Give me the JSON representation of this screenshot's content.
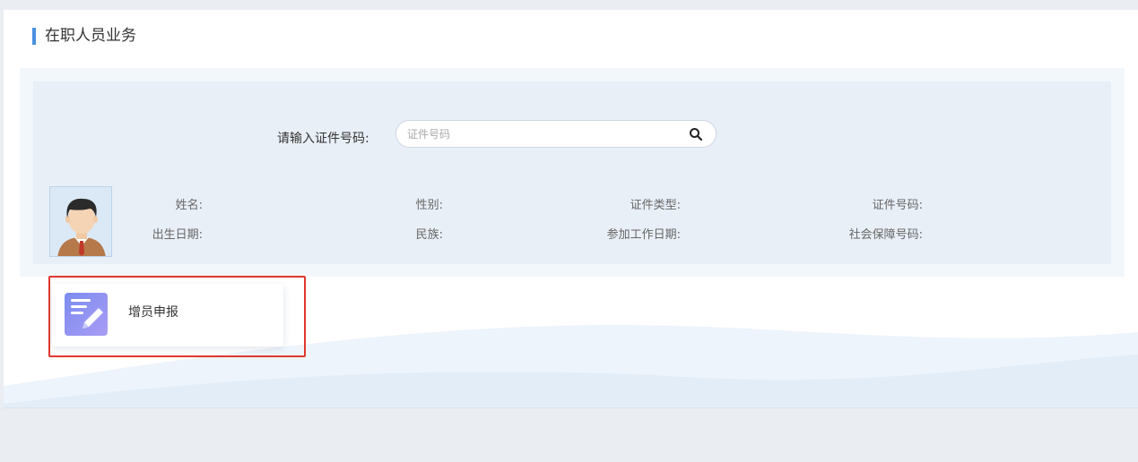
{
  "section": {
    "title": "在职人员业务"
  },
  "search": {
    "label": "请输入证件号码:",
    "placeholder": "证件号码",
    "value": ""
  },
  "person": {
    "name_label": "姓名:",
    "gender_label": "性别:",
    "id_type_label": "证件类型:",
    "id_number_label": "证件号码:",
    "birth_date_label": "出生日期:",
    "ethnicity_label": "民族:",
    "work_start_label": "参加工作日期:",
    "social_security_label": "社会保障号码:"
  },
  "actions": [
    {
      "label": "增员申报",
      "icon": "edit-document-icon"
    }
  ],
  "colors": {
    "accent": "#4a90e2",
    "highlight": "#e0382e",
    "query_bg": "#e8eff7",
    "icon_gradient_start": "#7b8cf0",
    "icon_gradient_end": "#a99cf5"
  }
}
